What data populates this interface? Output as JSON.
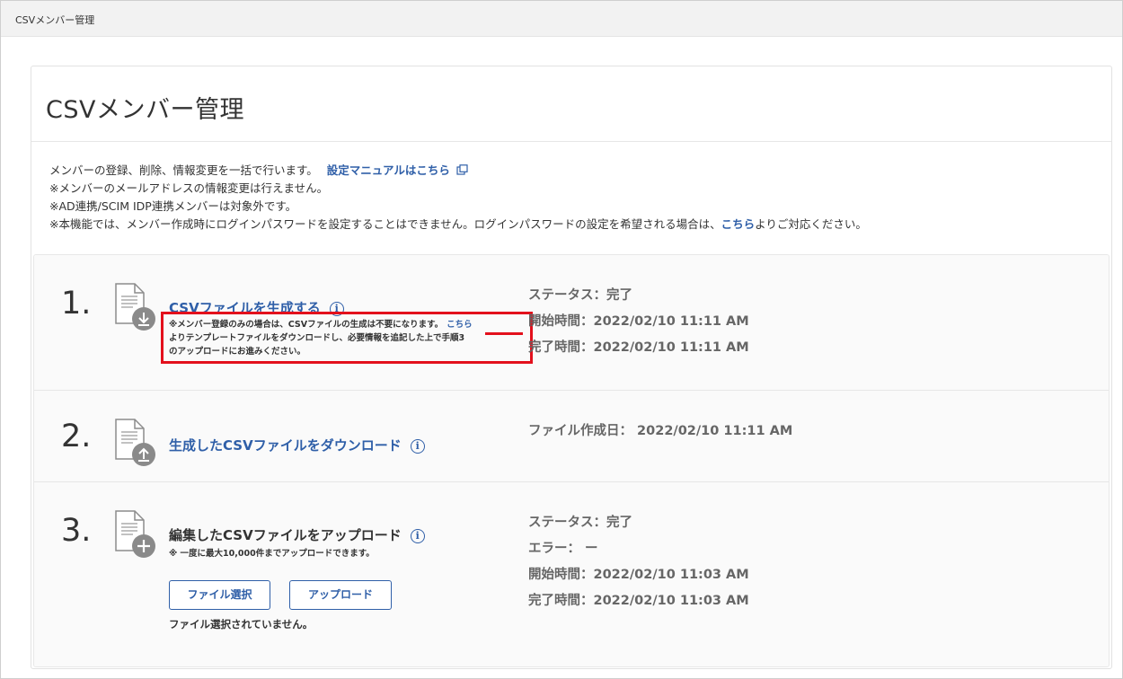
{
  "tab": {
    "title": "CSVメンバー管理"
  },
  "page": {
    "title": "CSVメンバー管理"
  },
  "intro": {
    "line1_text": "メンバーの登録、削除、情報変更を一括で行います。",
    "line1_link": "設定マニュアルはこちら",
    "line2": "※メンバーのメールアドレスの情報変更は行えません。",
    "line3": "※AD連携/SCIM IDP連携メンバーは対象外です。",
    "line4_before": "※本機能では、メンバー作成時にログインパスワードを設定することはできません。ログインパスワードの設定を希望される場合は、",
    "line4_link": "こちら",
    "line4_after": "よりご対応ください。"
  },
  "steps": {
    "s1": {
      "number": "1.",
      "title": "CSVファイルを生成する",
      "note_line1": "※メンバー登録のみの場合は、CSVファイルの生成は不要になります。",
      "note_link": "こちら",
      "note_line2": "よりテンプレートファイルをダウンロードし、必要情報を追記した上で手順3",
      "note_line3": "のアップロードにお進みください。",
      "status": "ステータス：完了",
      "start": "開始時間：2022/02/10 11:11 AM",
      "end": "完了時間：2022/02/10 11:11 AM"
    },
    "s2": {
      "number": "2.",
      "title": "生成したCSVファイルをダウンロード",
      "created": "ファイル作成日： 2022/02/10 11:11 AM"
    },
    "s3": {
      "number": "3.",
      "title": "編集したCSVファイルをアップロード",
      "note": "※ 一度に最大10,000件までアップロードできます。",
      "select_button": "ファイル選択",
      "upload_button": "アップロード",
      "file_status": "ファイル選択されていません。",
      "status": "ステータス：完了",
      "error": "エラー： ー",
      "start": "開始時間：2022/02/10 11:03 AM",
      "end": "完了時間：2022/02/10 11:03 AM"
    }
  },
  "icons": {
    "info": "i",
    "accent_color": "#2f5fa8",
    "highlight_color": "#e3101c"
  }
}
